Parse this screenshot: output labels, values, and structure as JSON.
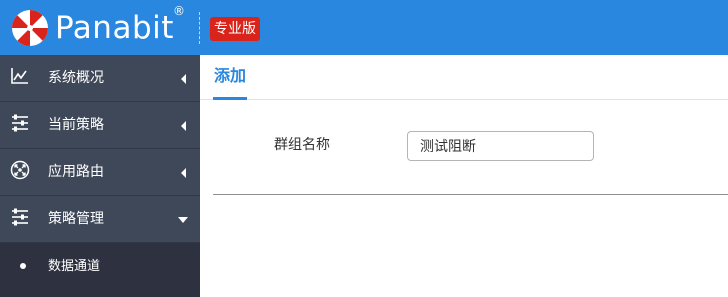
{
  "header": {
    "brand": "Panabit",
    "registered_mark": "®",
    "edition_badge": "专业版",
    "logo_icon": "umbrella-logo-icon",
    "colors": {
      "bar": "#2a87e0",
      "badge": "#d9241c"
    }
  },
  "sidebar": {
    "items": [
      {
        "label": "系统概况",
        "icon": "line-chart-icon",
        "expanded": false
      },
      {
        "label": "当前策略",
        "icon": "sliders-icon",
        "expanded": false
      },
      {
        "label": "应用路由",
        "icon": "route-hub-icon",
        "expanded": false
      },
      {
        "label": "策略管理",
        "icon": "sliders-icon",
        "expanded": true
      }
    ],
    "subitems": [
      {
        "label": "数据通道"
      }
    ]
  },
  "main": {
    "tab": "添加",
    "form": {
      "group_name_label": "群组名称",
      "group_name_value": "测试阻断"
    }
  }
}
